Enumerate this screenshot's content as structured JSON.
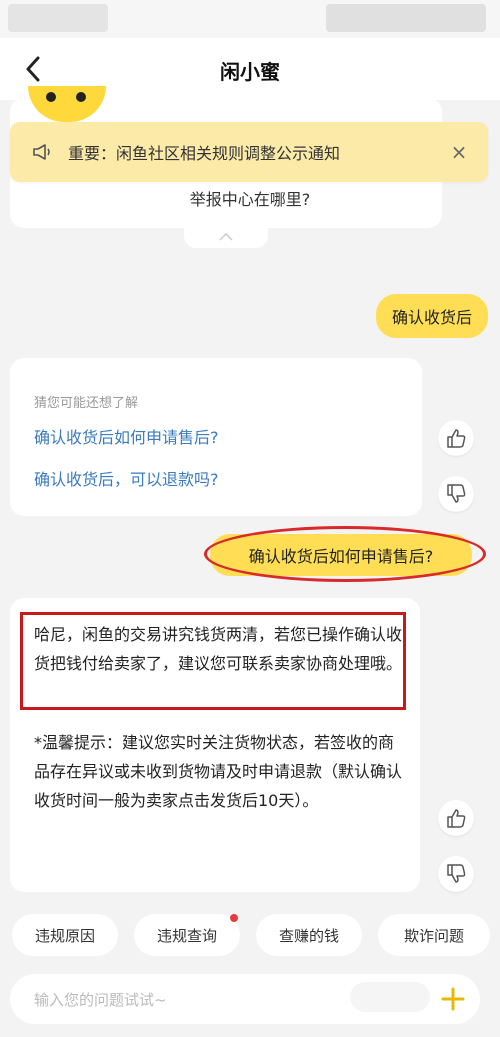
{
  "header": {
    "title": "闲小蜜"
  },
  "top_card": {
    "question": "举报中心在哪里?"
  },
  "notice": {
    "text": "重要：闲鱼社区相关规则调整公示通知",
    "close": "×"
  },
  "messages": {
    "user1": "确认收货后",
    "suggest_hint": "猜您可能还想了解",
    "suggest_links": [
      "确认收货后如何申请售后?",
      "确认收货后，可以退款吗?"
    ],
    "user2": "确认收货后如何申请售后?",
    "answer": "哈尼，闲鱼的交易讲究钱货两清，若您已操作确认收货把钱付给卖家了，建议您可联系卖家协商处理哦。",
    "tip": "*温馨提示：建议您实时关注货物状态，若签收的商品存在异议或未收到货物请及时申请退款（默认确认收货时间一般为卖家点击发货后10天）。"
  },
  "quick_replies": [
    "违规原因",
    "违规查询",
    "查赚的钱",
    "欺诈问题"
  ],
  "input": {
    "placeholder": "输入您的问题试试~"
  },
  "colors": {
    "accent_yellow": "#ffde55",
    "notice_bg": "#fbeaa8",
    "link_blue": "#3a7bbf",
    "highlight_red": "#d92a2a"
  }
}
